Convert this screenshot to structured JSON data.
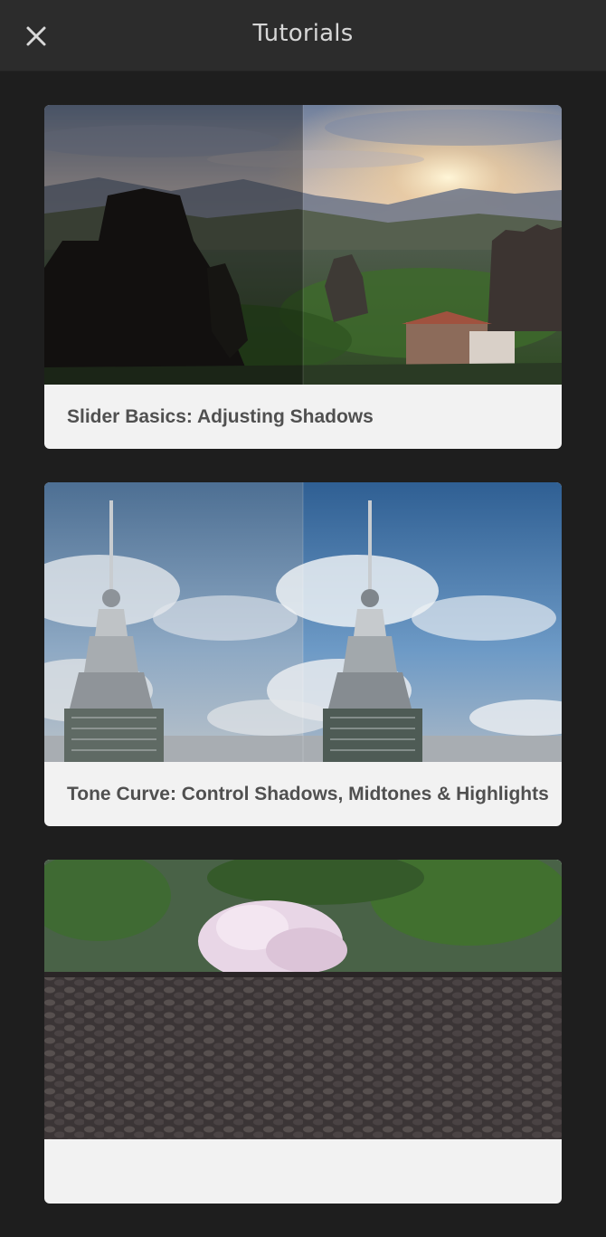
{
  "header": {
    "title": "Tutorials",
    "close_icon": "close-icon"
  },
  "tutorials": [
    {
      "title": "Slider Basics: Adjusting Shadows",
      "image": "mountain-sunset-thumbnail"
    },
    {
      "title": "Tone Curve: Control Shadows, Midtones & Highlights",
      "image": "tower-sky-thumbnail"
    },
    {
      "title": "",
      "image": "cherry-blossom-wall-thumbnail"
    }
  ],
  "colors": {
    "background": "#1e1e1e",
    "header": "#2c2c2c",
    "card": "#f2f2f2",
    "caption_text": "#505050"
  }
}
